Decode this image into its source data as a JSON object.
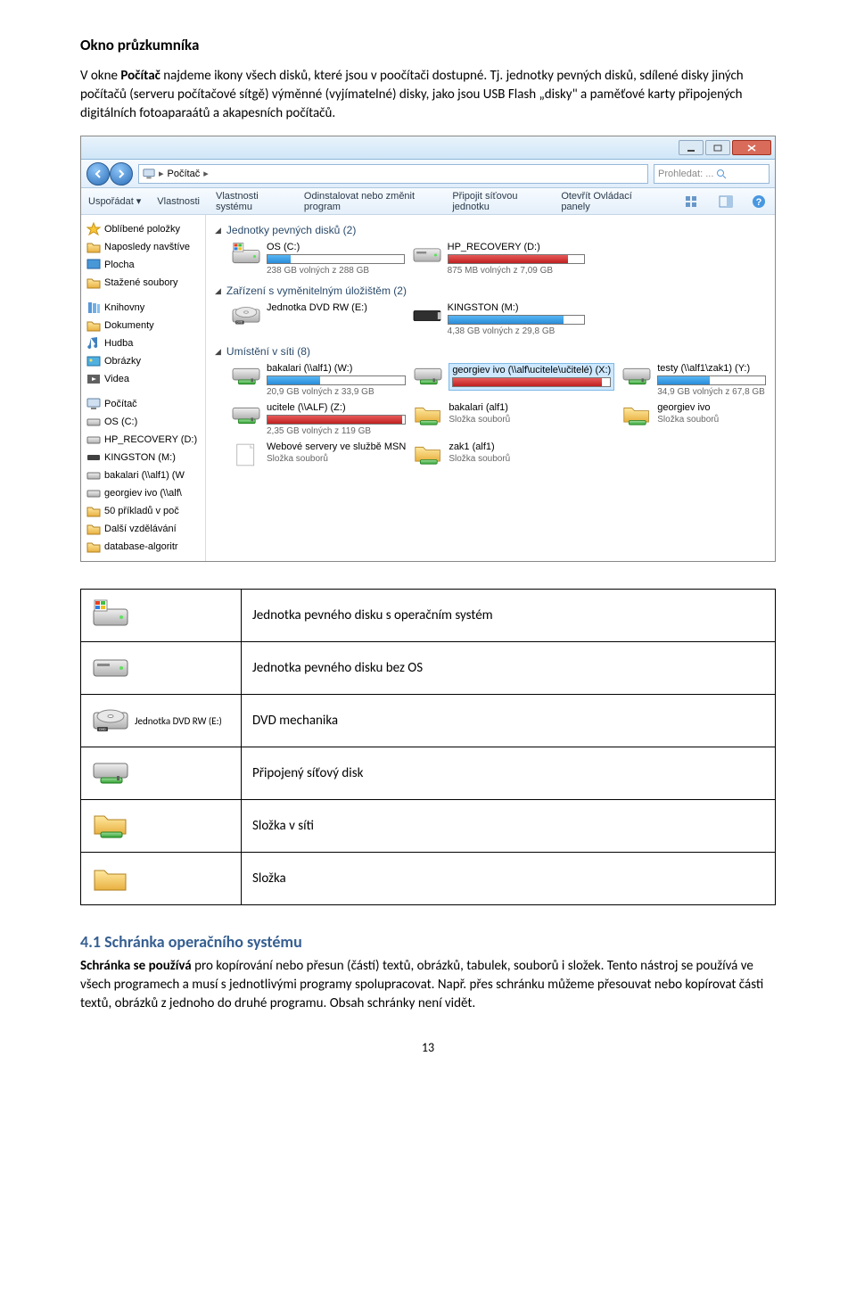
{
  "title": "Okno průzkumníka",
  "intro_1a": "V okne ",
  "intro_1b": "Počítač",
  "intro_1c": " najdeme ikony všech disků, které jsou v poočítači dostupné. Tj. jednotky pevných disků, sdílené disky jiných počítačů (serveru počítačové sítgě) výměnné (vyjímatelné) disky, jako jsou USB Flash „disky\" a paměťové karty připojených digitálních fotoaparaátů a akapesních počítačů.",
  "explorer": {
    "crumb": "Počítač",
    "search_placeholder": "Prohledat: ...",
    "toolbar": {
      "organize": "Uspořádat",
      "properties": "Vlastnosti",
      "sys_props": "Vlastnosti systému",
      "uninstall": "Odinstalovat nebo změnit program",
      "map_drive": "Připojit síťovou jednotku",
      "control_panel": "Otevřít Ovládací panely"
    },
    "sidebar": {
      "favorites": "Oblíbené položky",
      "recent": "Naposledy navštíve",
      "desktop": "Plocha",
      "downloads": "Stažené soubory",
      "libraries": "Knihovny",
      "documents": "Dokumenty",
      "music": "Hudba",
      "pictures": "Obrázky",
      "videos": "Videa",
      "computer": "Počítač",
      "os_c": "OS (C:)",
      "hp_rec": "HP_RECOVERY (D:)",
      "kingston": "KINGSTON (M:)",
      "bakalari": "bakalari (\\\\alf1) (W",
      "georgiev": "georgiev ivo (\\\\alf\\",
      "priklad": "50 příkladů v poč",
      "dalsi": "Další vzdělávání",
      "database": "database-algoritr"
    },
    "sections": {
      "hdd": "Jednotky pevných disků (2)",
      "removable": "Zařízení s vyměnitelným úložištěm (2)",
      "network": "Umístění v síti (8)"
    },
    "drives": {
      "os_c": {
        "name": "OS (C:)",
        "sub": "238 GB volných z 288 GB",
        "fill": 17
      },
      "hp": {
        "name": "HP_RECOVERY (D:)",
        "sub": "875 MB volných z 7,09 GB",
        "fill": 88
      },
      "dvd": {
        "name": "Jednotka DVD RW (E:)"
      },
      "kingston": {
        "name": "KINGSTON (M:)",
        "sub": "4,38 GB volných z 29,8 GB",
        "fill": 85
      },
      "bakalari_w": {
        "name": "bakalari (\\\\alf1) (W:)",
        "sub": "20,9 GB volných z 33,9 GB",
        "fill": 38
      },
      "georgiev_x": {
        "name": "georgiev ivo (\\\\alf\\ucitele\\učitelé) (X:)",
        "fill": 95
      },
      "testy_y": {
        "name": "testy (\\\\alf1\\zak1) (Y:)",
        "sub": "34,9 GB volných z 67,8 GB",
        "fill": 48
      },
      "ucitele_z": {
        "name": "ucitele (\\\\ALF) (Z:)",
        "sub": "2,35 GB volných z 119 GB",
        "fill": 98
      },
      "bakalari_alf1": {
        "name": "bakalari (alf1)",
        "sub": "Složka souborů"
      },
      "georgiev_f": {
        "name": "georgiev ivo",
        "sub": "Složka souborů"
      },
      "msn": {
        "name": "Webové servery ve službě MSN",
        "sub": "Složka souborů"
      },
      "zak1": {
        "name": "zak1 (alf1)",
        "sub": "Složka souborů"
      }
    }
  },
  "icon_table": {
    "rows": [
      {
        "label": "Jednotka pevného disku s operačním systém"
      },
      {
        "label": "Jednotka pevného disku bez OS"
      },
      {
        "label": "DVD mechanika",
        "extra": "Jednotka DVD RW (E:)"
      },
      {
        "label": "Připojený síťový disk"
      },
      {
        "label": "Složka v síti"
      },
      {
        "label": "Složka"
      }
    ]
  },
  "heading_4_1": "4.1   Schránka operačního systému",
  "para_4_1a": "Schránka se používá",
  "para_4_1b": " pro kopírování nebo přesun (částí) textů, obrázků, tabulek, souborů i složek. Tento nástroj se používá ve všech programech a musí s jednotlivými programy spolupracovat. Např. přes schránku můžeme přesouvat nebo kopírovat části textů, obrázků z jednoho do druhé programu. Obsah schránky není vidět.",
  "page": "13"
}
